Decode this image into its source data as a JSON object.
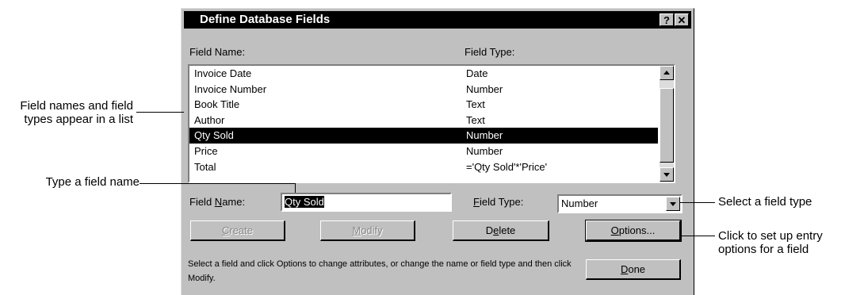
{
  "dialog": {
    "title": "Define Database Fields",
    "help_glyph": "?",
    "close_glyph": "✕",
    "column_headers": {
      "name": "Field Name:",
      "type": "Field Type:"
    },
    "fields": [
      {
        "name": "Invoice Date",
        "type": "Date"
      },
      {
        "name": "Invoice Number",
        "type": "Number"
      },
      {
        "name": "Book Title",
        "type": "Text"
      },
      {
        "name": "Author",
        "type": "Text"
      },
      {
        "name": "Qty Sold",
        "type": "Number",
        "selected": true
      },
      {
        "name": "Price",
        "type": "Number"
      },
      {
        "name": "Total",
        "type": "='Qty Sold'*'Price'"
      }
    ],
    "field_name_label": "Field Name:",
    "field_name_value": "Qty Sold",
    "field_type_label": "Field Type:",
    "field_type_value": "Number",
    "buttons": {
      "create": "Create",
      "modify": "Modify",
      "delete": "Delete",
      "options": "Options...",
      "done": "Done"
    },
    "help_text": "Select a field and click Options to change attributes, or change the name or field type and then click Modify."
  },
  "annotations": {
    "list": "Field names and field types appear in a list",
    "type_name": "Type a field name",
    "select_type": "Select a field type",
    "options": "Click to set up entry options for a field"
  }
}
